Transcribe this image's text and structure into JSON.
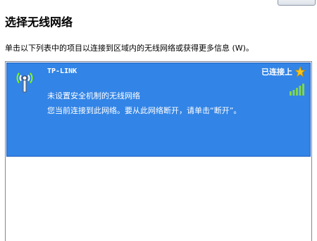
{
  "heading": "选择无线网络",
  "instruction": "单击以下列表中的项目以连接到区域内的无线网络或获得更多信息 (W)。",
  "networks": [
    {
      "ssid": "TP-LINK",
      "status": "已连接上",
      "security": "未设置安全机制的无线网络",
      "message": "您当前连接到此网络。要从此网络断开，请单击“断开”。",
      "icons": {
        "access_point": "wireless-access-point-icon",
        "status": "star-icon",
        "signal": "signal-strength-icon"
      }
    }
  ],
  "colors": {
    "selected_background": "#3284e6",
    "star": "#f6c51b",
    "signal": "#7fd64a"
  }
}
